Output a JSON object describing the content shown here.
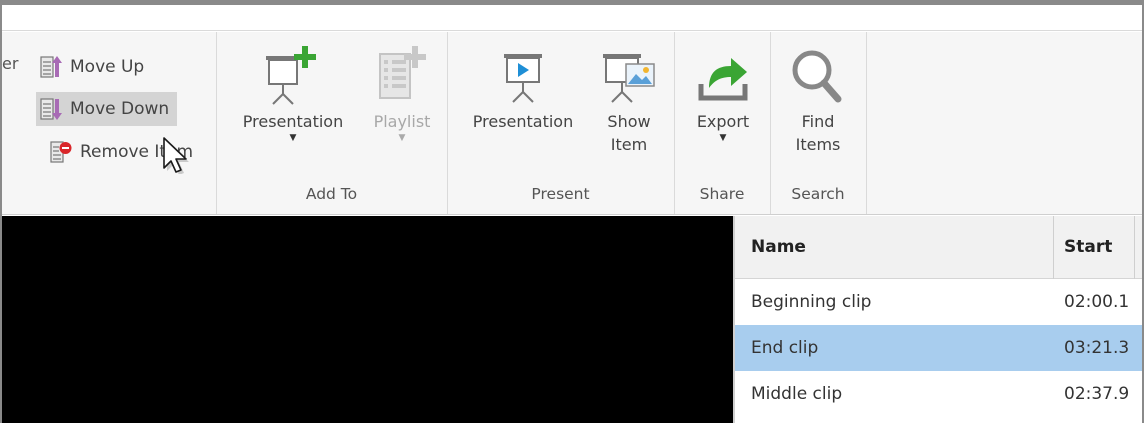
{
  "ribbon": {
    "order_partial": "er",
    "move_up": "Move Up",
    "move_down": "Move Down",
    "remove_item": "Remove Item",
    "add_to": {
      "label": "Add To",
      "presentation": "Presentation",
      "playlist": "Playlist"
    },
    "present": {
      "label": "Present",
      "presentation": "Presentation",
      "show_item_line1": "Show",
      "show_item_line2": "Item"
    },
    "share": {
      "label": "Share",
      "export": "Export"
    },
    "search": {
      "label": "Search",
      "find_line1": "Find",
      "find_line2": "Items"
    }
  },
  "grid": {
    "columns": [
      "Name",
      "Start"
    ],
    "rows": [
      {
        "name": "Beginning clip",
        "start": "02:00.1",
        "selected": false
      },
      {
        "name": "End clip",
        "start": "03:21.3",
        "selected": true
      },
      {
        "name": "Middle clip",
        "start": "02:37.9",
        "selected": false
      }
    ]
  },
  "colors": {
    "accent_green": "#3aa534",
    "accent_purple": "#a86bb5",
    "accent_red": "#d9262a",
    "accent_blue": "#1f8fd6",
    "selection": "#a8cdee"
  }
}
